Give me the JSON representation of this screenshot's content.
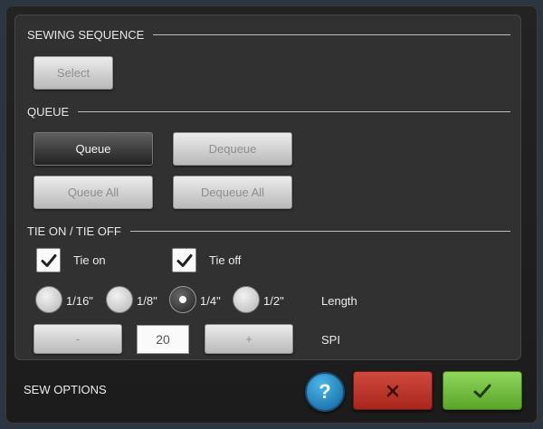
{
  "sections": {
    "sewing_sequence": "SEWING SEQUENCE",
    "queue": "QUEUE",
    "tie": "TIE ON / TIE OFF"
  },
  "sewing_sequence": {
    "select_label": "Select"
  },
  "queue": {
    "queue_label": "Queue",
    "dequeue_label": "Dequeue",
    "queue_all_label": "Queue All",
    "dequeue_all_label": "Dequeue All",
    "active": "Queue"
  },
  "tie": {
    "tie_on": {
      "label": "Tie on",
      "checked": true
    },
    "tie_off": {
      "label": "Tie off",
      "checked": true
    },
    "length_options": [
      "1/16\"",
      "1/8\"",
      "1/4\"",
      "1/2\""
    ],
    "length_selected": "1/4\"",
    "length_label": "Length",
    "spi": {
      "minus_label": "-",
      "value": "20",
      "plus_label": "+",
      "label": "SPI"
    }
  },
  "footer": {
    "title": "SEW OPTIONS",
    "help_label": "?",
    "help_icon": "help-icon",
    "cancel_icon": "close-icon",
    "ok_icon": "checkmark-icon"
  },
  "colors": {
    "cancel": "#c0392b",
    "ok": "#7bc443",
    "help": "#2a90cf"
  }
}
